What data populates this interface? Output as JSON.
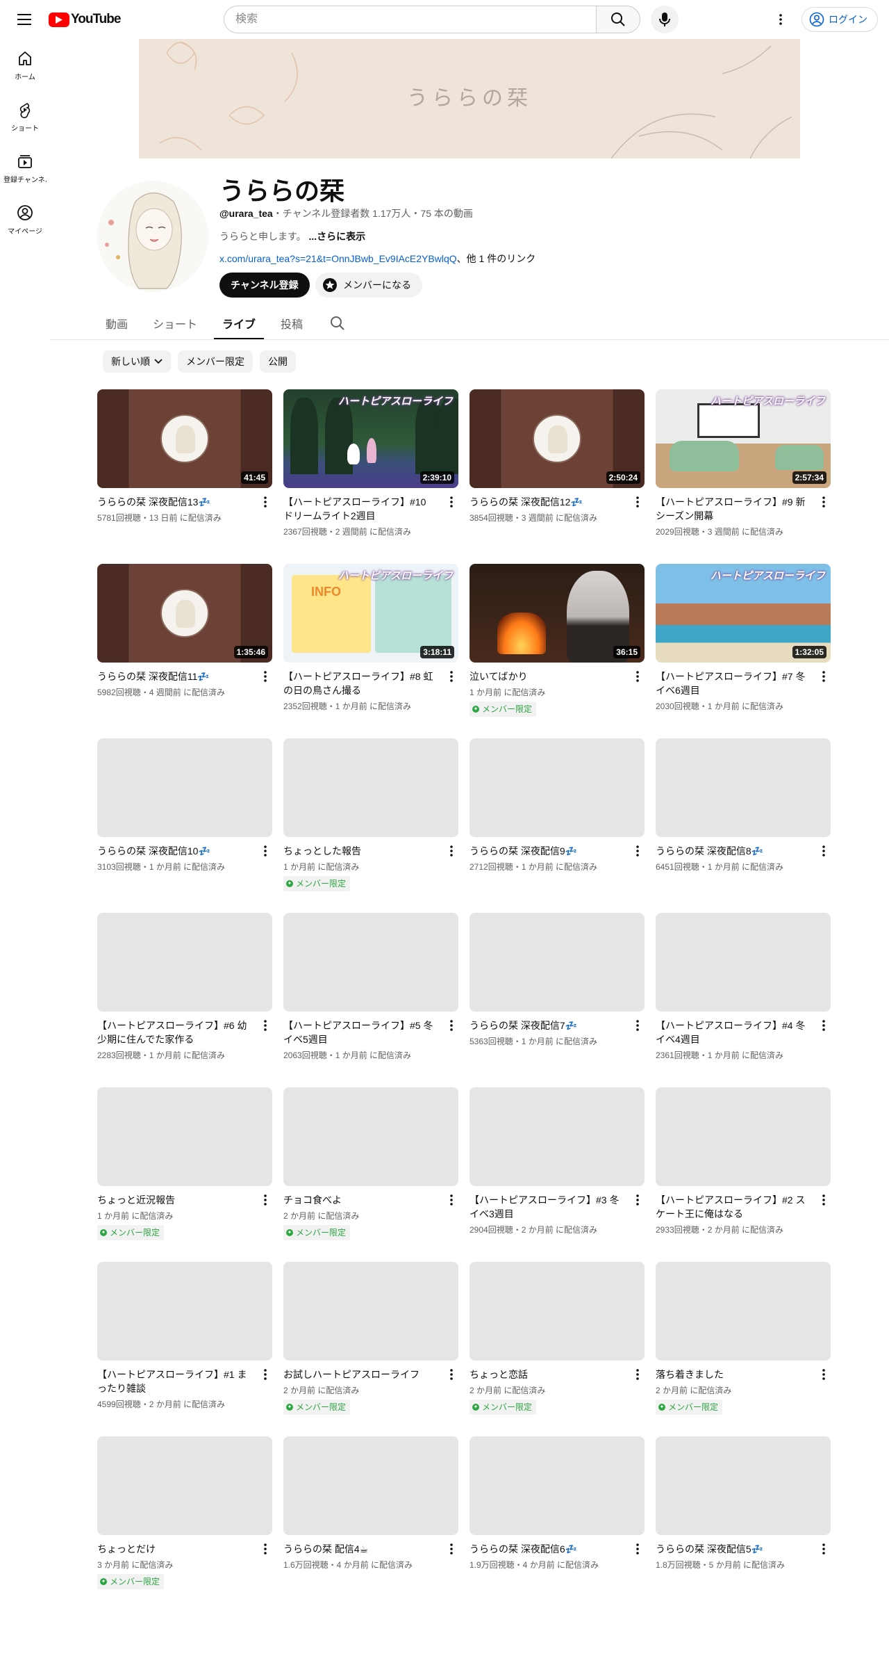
{
  "header": {
    "logo_text": "YouTube",
    "search_placeholder": "検索",
    "login_label": "ログイン"
  },
  "sidebar": {
    "items": [
      {
        "label": "ホーム",
        "icon": "home-icon"
      },
      {
        "label": "ショート",
        "icon": "shorts-icon"
      },
      {
        "label": "登録チャンネル",
        "icon": "subscriptions-icon"
      },
      {
        "label": "マイページ",
        "icon": "you-icon"
      }
    ]
  },
  "banner": {
    "title": "うららの栞"
  },
  "channel": {
    "name": "うららの栞",
    "handle": "@urara_tea",
    "meta": "・チャンネル登録者数 1.17万人・75 本の動画",
    "description": "うららと申します。",
    "more_label": "...さらに表示",
    "link": "x.com/urara_tea?s=21&t=OnnJBwb_Ev9IAcE2YBwlqQ",
    "link_others": "、他 1 件のリンク",
    "subscribe_label": "チャンネル登録",
    "member_label": "メンバーになる"
  },
  "tabs": [
    {
      "label": "動画",
      "active": false
    },
    {
      "label": "ショート",
      "active": false
    },
    {
      "label": "ライブ",
      "active": true
    },
    {
      "label": "投稿",
      "active": false
    }
  ],
  "chips": [
    {
      "label": "新しい順",
      "dropdown": true
    },
    {
      "label": "メンバー限定",
      "dropdown": false
    },
    {
      "label": "公開",
      "dropdown": false
    }
  ],
  "member_badge_label": "メンバー限定",
  "videos": [
    {
      "title": "うららの栞 深夜配信13💤",
      "meta": "5781回視聴・13 日前 に配信済み",
      "duration": "41:45",
      "art": "stream",
      "member": false
    },
    {
      "title": "【ハートピアスローライフ】#10 ドリームライト2週目",
      "meta": "2367回視聴・2 週間前 に配信済み",
      "duration": "2:39:10",
      "art": "forest",
      "member": false
    },
    {
      "title": "うららの栞 深夜配信12💤",
      "meta": "3854回視聴・3 週間前 に配信済み",
      "duration": "2:50:24",
      "art": "stream",
      "member": false
    },
    {
      "title": "【ハートピアスローライフ】#9 新シーズン開幕",
      "meta": "2029回視聴・3 週間前 に配信済み",
      "duration": "2:57:34",
      "art": "garage",
      "member": false
    },
    {
      "title": "うららの栞 深夜配信11💤",
      "meta": "5982回視聴・4 週間前 に配信済み",
      "duration": "1:35:46",
      "art": "stream",
      "member": false
    },
    {
      "title": "【ハートピアスローライフ】#8 虹の日の鳥さん撮る",
      "meta": "2352回視聴・1 か月前 に配信済み",
      "duration": "3:18:11",
      "art": "calendar",
      "member": false
    },
    {
      "title": "泣いてばかり",
      "meta": "1 か月前 に配信済み",
      "duration": "36:15",
      "art": "fire",
      "member": true
    },
    {
      "title": "【ハートピアスローライフ】#7 冬イベ6週目",
      "meta": "2030回視聴・1 か月前 に配信済み",
      "duration": "1:32:05",
      "art": "beach",
      "member": false
    },
    {
      "title": "うららの栞 深夜配信10💤",
      "meta": "3103回視聴・1 か月前 に配信済み",
      "duration": "",
      "art": "blank",
      "member": false
    },
    {
      "title": "ちょっとした報告",
      "meta": "1 か月前 に配信済み",
      "duration": "",
      "art": "blank",
      "member": true
    },
    {
      "title": "うららの栞 深夜配信9💤",
      "meta": "2712回視聴・1 か月前 に配信済み",
      "duration": "",
      "art": "blank",
      "member": false
    },
    {
      "title": "うららの栞 深夜配信8💤",
      "meta": "6451回視聴・1 か月前 に配信済み",
      "duration": "",
      "art": "blank",
      "member": false
    },
    {
      "title": "【ハートピアスローライフ】#6 幼少期に住んでた家作る",
      "meta": "2283回視聴・1 か月前 に配信済み",
      "duration": "",
      "art": "blank",
      "member": false
    },
    {
      "title": "【ハートピアスローライフ】#5 冬イベ5週目",
      "meta": "2063回視聴・1 か月前 に配信済み",
      "duration": "",
      "art": "blank",
      "member": false
    },
    {
      "title": "うららの栞 深夜配信7💤",
      "meta": "5363回視聴・1 か月前 に配信済み",
      "duration": "",
      "art": "blank",
      "member": false
    },
    {
      "title": "【ハートピアスローライフ】#4 冬イベ4週目",
      "meta": "2361回視聴・1 か月前 に配信済み",
      "duration": "",
      "art": "blank",
      "member": false
    },
    {
      "title": "ちょっと近況報告",
      "meta": "1 か月前 に配信済み",
      "duration": "",
      "art": "blank",
      "member": true
    },
    {
      "title": "チョコ食べよ",
      "meta": "2 か月前 に配信済み",
      "duration": "",
      "art": "blank",
      "member": true
    },
    {
      "title": "【ハートピアスローライフ】#3 冬イベ3週目",
      "meta": "2904回視聴・2 か月前 に配信済み",
      "duration": "",
      "art": "blank",
      "member": false
    },
    {
      "title": "【ハートピアスローライフ】#2 スケート王に俺はなる",
      "meta": "2933回視聴・2 か月前 に配信済み",
      "duration": "",
      "art": "blank",
      "member": false
    },
    {
      "title": "【ハートピアスローライフ】#1 まったり雑談",
      "meta": "4599回視聴・2 か月前 に配信済み",
      "duration": "",
      "art": "blank",
      "member": false
    },
    {
      "title": "お試しハートピアスローライフ",
      "meta": "2 か月前 に配信済み",
      "duration": "",
      "art": "blank",
      "member": true
    },
    {
      "title": "ちょっと恋話",
      "meta": "2 か月前 に配信済み",
      "duration": "",
      "art": "blank",
      "member": true
    },
    {
      "title": "落ち着きました",
      "meta": "2 か月前 に配信済み",
      "duration": "",
      "art": "blank",
      "member": true
    },
    {
      "title": "ちょっとだけ",
      "meta": "3 か月前 に配信済み",
      "duration": "",
      "art": "blank",
      "member": true
    },
    {
      "title": "うららの栞 配信4☕",
      "meta": "1.6万回視聴・4 か月前 に配信済み",
      "duration": "",
      "art": "blank",
      "member": false
    },
    {
      "title": "うららの栞 深夜配信6💤",
      "meta": "1.9万回視聴・4 か月前 に配信済み",
      "duration": "",
      "art": "blank",
      "member": false
    },
    {
      "title": "うららの栞 深夜配信5💤",
      "meta": "1.8万回視聴・5 か月前 に配信済み",
      "duration": "",
      "art": "blank",
      "member": false
    }
  ],
  "thumbnail_logo_text": "ハートピアスローライフ",
  "calendar_art_text": "INFO",
  "colors": {
    "brand_red": "#ff0000",
    "link_blue": "#065fd4",
    "member_green": "#2ba640"
  }
}
